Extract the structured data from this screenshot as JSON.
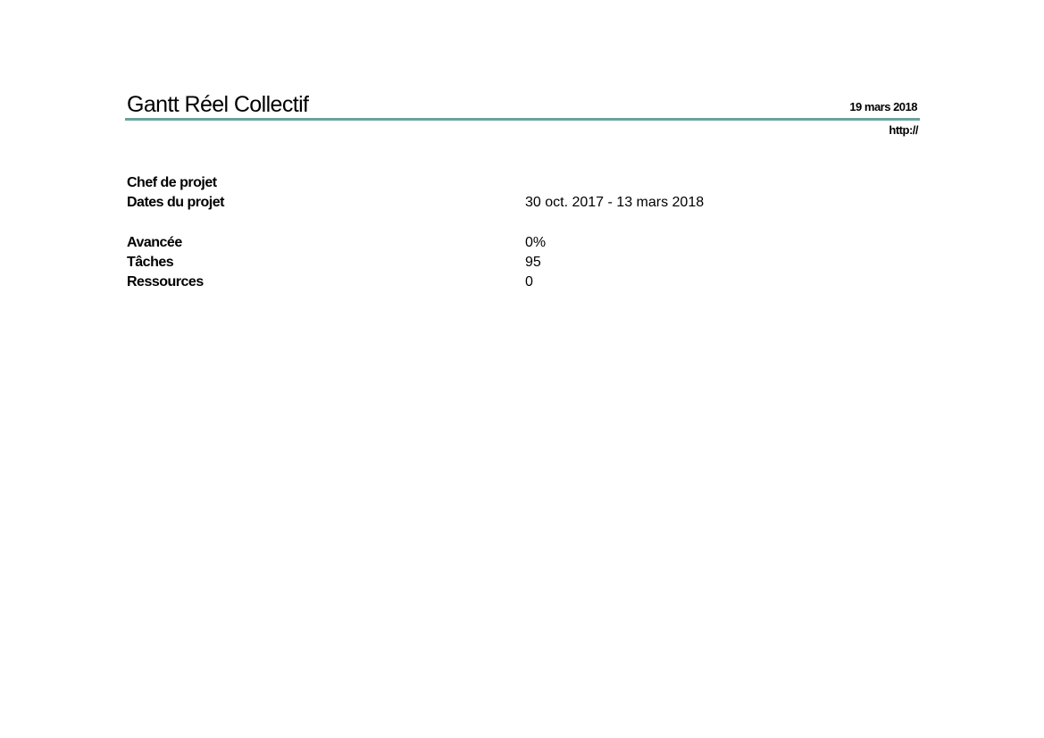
{
  "header": {
    "title": "Gantt Réel Collectif",
    "date": "19 mars 2018",
    "url": "http://"
  },
  "project": {
    "manager_label": "Chef de projet",
    "manager_value": "",
    "dates_label": "Dates du projet",
    "dates_value": "30 oct. 2017 - 13 mars 2018",
    "progress_label": "Avancée",
    "progress_value": "0%",
    "tasks_label": "Tâches",
    "tasks_value": "95",
    "resources_label": "Ressources",
    "resources_value": "0"
  },
  "colors": {
    "rule": "#6aa39a"
  }
}
